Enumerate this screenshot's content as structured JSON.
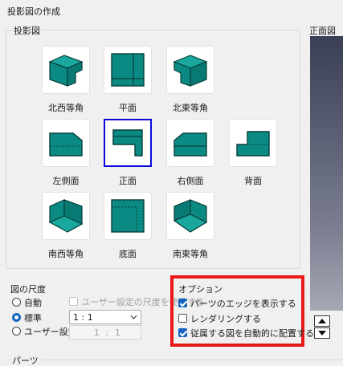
{
  "window": {
    "title": "投影図の作成"
  },
  "projection_group": {
    "label": "投影図"
  },
  "views": [
    {
      "label": "北西等角",
      "icon": "isometric-northwest-icon",
      "selected": false
    },
    {
      "label": "平面",
      "icon": "top-view-icon",
      "selected": false
    },
    {
      "label": "北東等角",
      "icon": "isometric-northeast-icon",
      "selected": false
    },
    {
      "label": "左側面",
      "icon": "left-view-icon",
      "selected": false
    },
    {
      "label": "正面",
      "icon": "front-view-icon",
      "selected": true
    },
    {
      "label": "右側面",
      "icon": "right-view-icon",
      "selected": false
    },
    {
      "label": "背面",
      "icon": "back-view-icon",
      "selected": false
    },
    {
      "label": "南西等角",
      "icon": "isometric-southwest-icon",
      "selected": false
    },
    {
      "label": "底面",
      "icon": "bottom-view-icon",
      "selected": false
    },
    {
      "label": "南東等角",
      "icon": "isometric-southeast-icon",
      "selected": false
    }
  ],
  "scale": {
    "label": "図の尺度",
    "auto": "自動",
    "standard": "標準",
    "user": "ユーザー設定",
    "use_user_scale": "ユーザー設定の尺度を使用する",
    "standard_value": "1 : 1",
    "user_left": "1",
    "user_sep": ":",
    "user_right": "1",
    "selected": "standard"
  },
  "options": {
    "label": "オプション",
    "show_edges": "パーツのエッジを表示する",
    "rendering": "レンダリングする",
    "auto_place": "従属する図を自動的に配置する",
    "show_edges_checked": true,
    "rendering_checked": false,
    "auto_place_checked": true,
    "highlight_color": "#e81919"
  },
  "preview": {
    "label": "正面図"
  },
  "parts": {
    "label": "パーツ"
  },
  "colors": {
    "teal": "#0a8a82",
    "dark": "#063f3b",
    "selection": "#0a0adf"
  }
}
